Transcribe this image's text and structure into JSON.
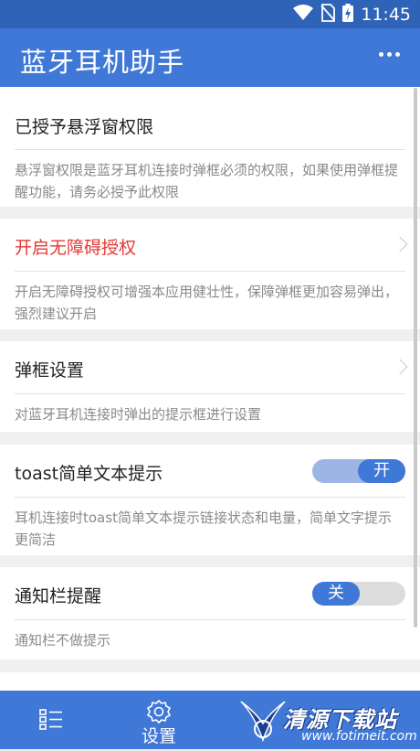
{
  "status_bar": {
    "time": "11:45"
  },
  "app_bar": {
    "title": "蓝牙耳机助手"
  },
  "sections": [
    {
      "title": "已授予悬浮窗权限",
      "description": "悬浮窗权限是蓝牙耳机连接时弹框必须的权限，如果使用弹框提醒功能，请务必授予此权限"
    },
    {
      "title": "开启无障碍授权",
      "description": "开启无障碍授权可增强本应用健壮性，保障弹框更加容易弹出，强烈建议开启"
    },
    {
      "title": "弹框设置",
      "description": "对蓝牙耳机连接时弹出的提示框进行设置"
    },
    {
      "title": "toast简单文本提示",
      "toggle": "开",
      "description": "耳机连接时toast简单文本提示链接状态和电量，简单文字提示更简洁"
    },
    {
      "title": "通知栏提醒",
      "toggle": "关",
      "description": "通知栏不做提示"
    }
  ],
  "bottom_nav": {
    "settings_label": "设置"
  },
  "watermark": {
    "text": "清源下载站",
    "url": "www.fotimeit.com"
  },
  "colors": {
    "primary": "#3f78d6",
    "status_bar": "#2e63b8",
    "warning_text": "#e53935"
  }
}
